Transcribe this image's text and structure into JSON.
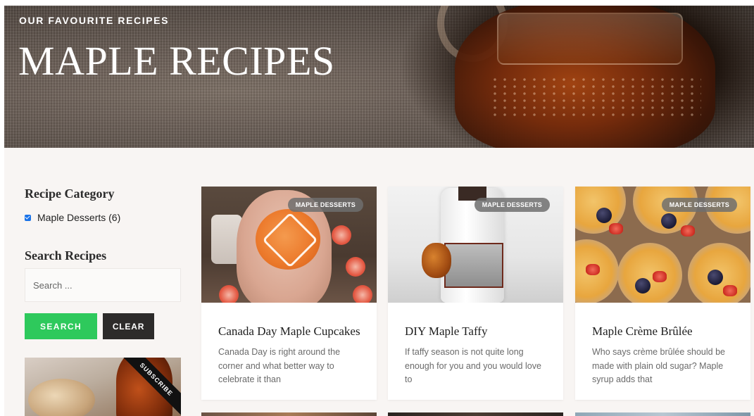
{
  "hero": {
    "eyebrow": "OUR FAVOURITE RECIPES",
    "title": "MAPLE RECIPES"
  },
  "sidebar": {
    "category_heading": "Recipe Category",
    "categories": [
      {
        "label": "Maple Desserts (6)",
        "checked": true
      }
    ],
    "search_heading": "Search Recipes",
    "search_placeholder": "Search ...",
    "search_button": "SEARCH",
    "clear_button": "CLEAR",
    "promo_ribbon": "SUBSCRIBE"
  },
  "cards": [
    {
      "badge": "MAPLE DESSERTS",
      "title": "Canada Day Maple Cupcakes",
      "excerpt": "Canada Day is right around the corner and what better way to celebrate it than"
    },
    {
      "badge": "MAPLE DESSERTS",
      "title": "DIY Maple Taffy",
      "excerpt": "If taffy season is not quite long enough for you and you would love to"
    },
    {
      "badge": "MAPLE DESSERTS",
      "title": "Maple Crème Brûlée",
      "excerpt": "Who says crème brûlée should be made with plain old sugar? Maple syrup adds that"
    }
  ],
  "colors": {
    "search_button": "#2ec95c",
    "clear_button": "#2d2b2a",
    "checkbox": "#1a73e8",
    "page_background": "#f8f5f3"
  }
}
